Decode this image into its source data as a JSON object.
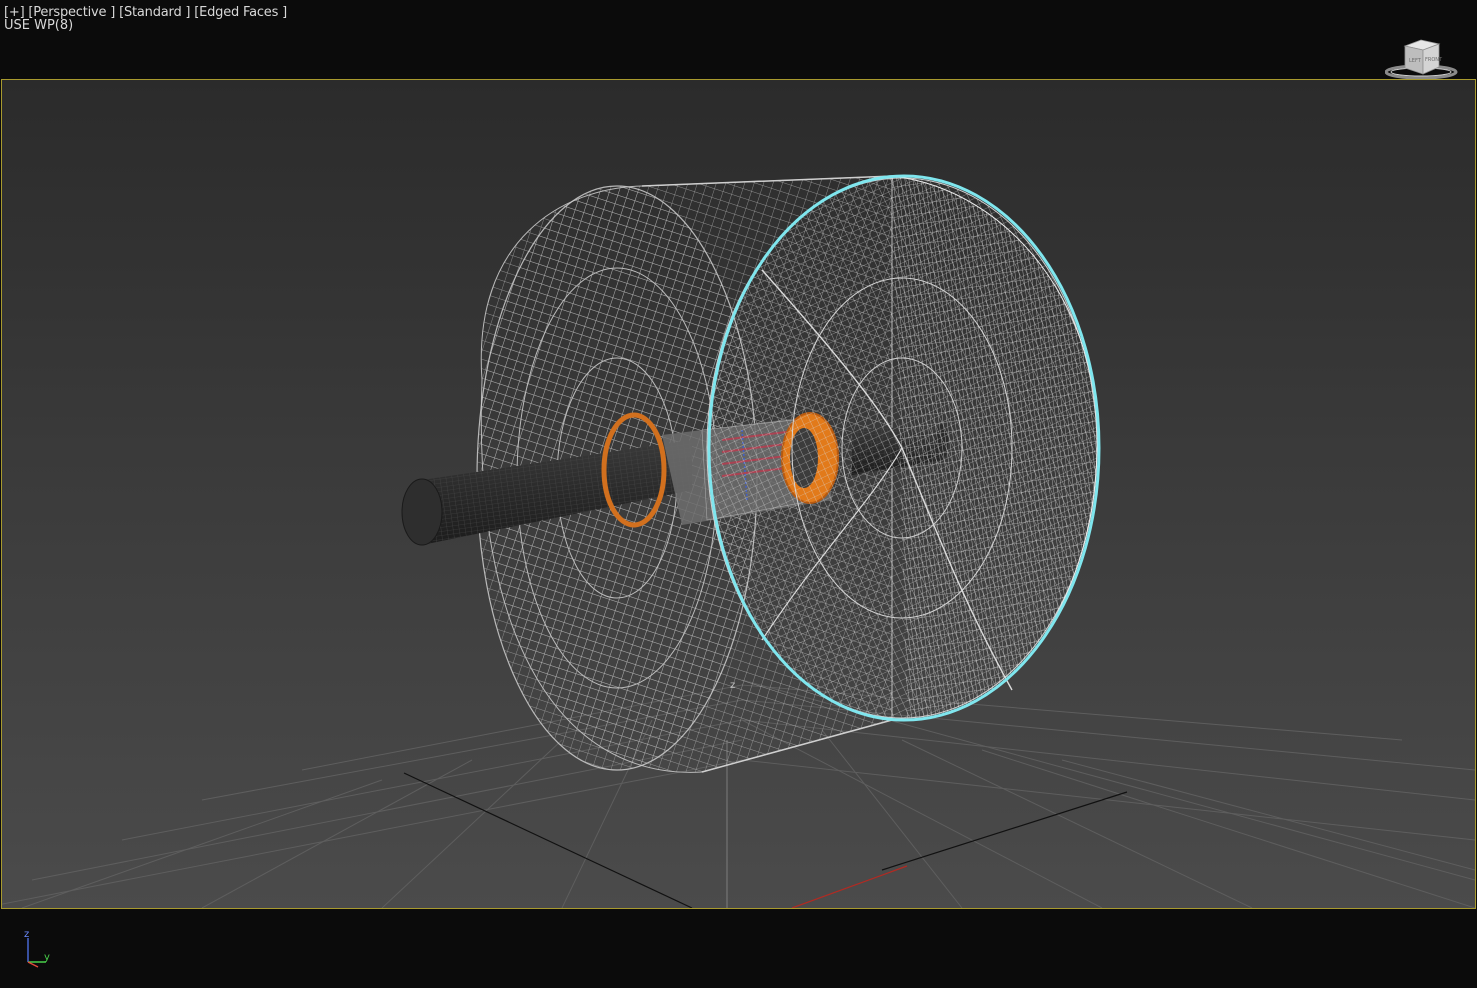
{
  "viewport": {
    "label_plus": "[+]",
    "label_view": "[Perspective ]",
    "label_shading": "[Standard ]",
    "label_edges": "[Edged Faces ]",
    "workplane": "USE WP(8)",
    "frame_color": "#a89a2e",
    "selection_color": "#7fe6ee"
  },
  "viewcube": {
    "icon": "viewcube-icon",
    "face_left": "LEFT",
    "face_front": "FRONT"
  },
  "scene": {
    "grid_label": "z",
    "objects": [
      "drum-wheel",
      "shaft",
      "bearing-hub"
    ]
  },
  "axis_tripod": {
    "z": "z",
    "y": "y",
    "x": "x"
  }
}
